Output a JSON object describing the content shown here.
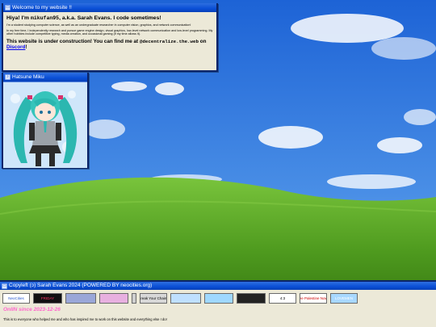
{
  "welcome_window": {
    "title": "Welcome to my website !!",
    "greeting_prefix": "Hiya! I'm ",
    "handle": "mikufan95",
    "greeting_suffix": ", a.k.a. Sarah Evans. I code sometimes!",
    "bio_1": "I'm a student studying computer science, as well as an undergraduate researcher in computer vision, graphics, and network communication!",
    "bio_2": "In my free time, I independently research and pursue game engine design, visual graphics, low-level network communication and low-level programming. My other hobbies include competitive typing, media creation, and occasional gaming (if my time allows it).",
    "notice_1": "This website is under construction! You can find me at ",
    "contact_handle": "@decentralize.the.web",
    "notice_2": " on ",
    "discord_label": "Discord",
    "notice_end": "!"
  },
  "miku_window": {
    "title": "Hatsune Miku"
  },
  "footer": {
    "title": "Copyleft (ↄ) Sarah Evans 2024 (POWERED BY neocities.org)",
    "badges": [
      {
        "label": "NeoCities",
        "bg": "#ffffff",
        "fg": "#2255cc"
      },
      {
        "label": "FRIDAY",
        "bg": "#111111",
        "fg": "#ff3366"
      },
      {
        "label": "",
        "bg": "#9aa7d8",
        "fg": "#000"
      },
      {
        "label": "",
        "bg": "#e8b0e0",
        "fg": "#000"
      },
      {
        "label": "",
        "bg": "#cfcfcf",
        "fg": "#000"
      },
      {
        "label": "Break Your Chains",
        "bg": "#d8d8d8",
        "fg": "#000"
      },
      {
        "label": "",
        "bg": "#bfe0ff",
        "fg": "#000"
      },
      {
        "label": "",
        "bg": "#9fd8ff",
        "fg": "#000"
      },
      {
        "label": "",
        "bg": "#222222",
        "fg": "#fff"
      },
      {
        "label": "4:3",
        "bg": "#ffffff",
        "fg": "#000"
      },
      {
        "label": "Free Palestine Now!!!",
        "bg": "#ffffff",
        "fg": "#d00000"
      },
      {
        "label": "LOVEMEN",
        "bg": "#a8d8ff",
        "fg": "#ffffff"
      }
    ],
    "online_text": "OnIIN since 2023-12-26",
    "thanks_text": "This is to everyone who helped me and who has inspired me to work on this website and everything else I do!"
  }
}
